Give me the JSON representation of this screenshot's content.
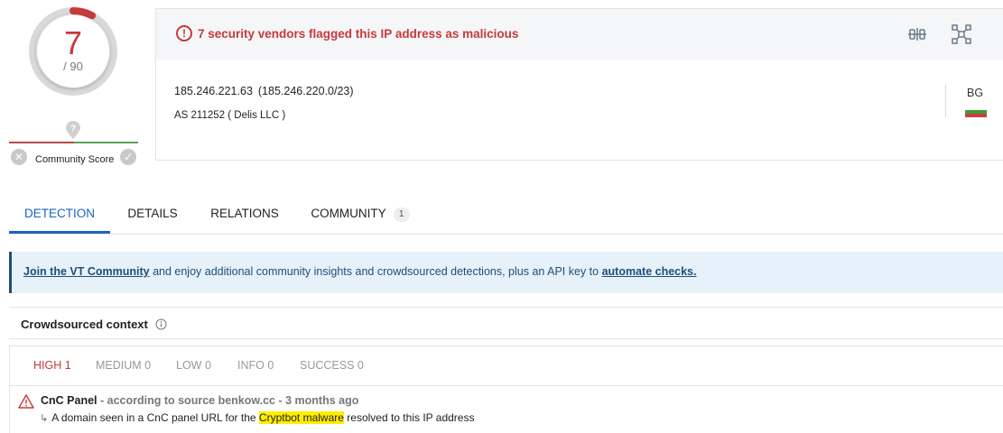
{
  "score": {
    "detections": "7",
    "total": "/ 90",
    "detection_fraction": 0.0778
  },
  "community": {
    "label": "Community Score",
    "unknown_icon": "question-pin-icon"
  },
  "header": {
    "alert_text": "7 security vendors flagged this IP address as malicious",
    "alert_color": "#c73a3a"
  },
  "ip": {
    "address": "185.246.221.63",
    "range": "(185.246.220.0/23)",
    "as_line": "AS 211252 ( Delis LLC )",
    "country_code": "BG"
  },
  "tabs": [
    {
      "label": "DETECTION"
    },
    {
      "label": "DETAILS"
    },
    {
      "label": "RELATIONS"
    },
    {
      "label": "COMMUNITY",
      "badge": "1"
    }
  ],
  "banner": {
    "link1": "Join the VT Community",
    "middle": " and enjoy additional community insights and crowdsourced detections, plus an API key to ",
    "link2": "automate checks."
  },
  "crowdsourced": {
    "title": "Crowdsourced context",
    "filters": [
      "HIGH 1",
      "MEDIUM 0",
      "LOW 0",
      "INFO 0",
      "SUCCESS 0"
    ],
    "result": {
      "name": "CnC Panel",
      "meta": " - according to source benkow.cc - 3 months ago",
      "desc_pre": "A domain seen in a CnC panel URL for the ",
      "desc_highlight": "Cryptbot malware",
      "desc_post": " resolved to this IP address"
    }
  },
  "colors": {
    "accent": "#1b63c5",
    "danger": "#c73a3a",
    "banner_bg": "#e7f1fa",
    "highlight": "#ffee00"
  }
}
